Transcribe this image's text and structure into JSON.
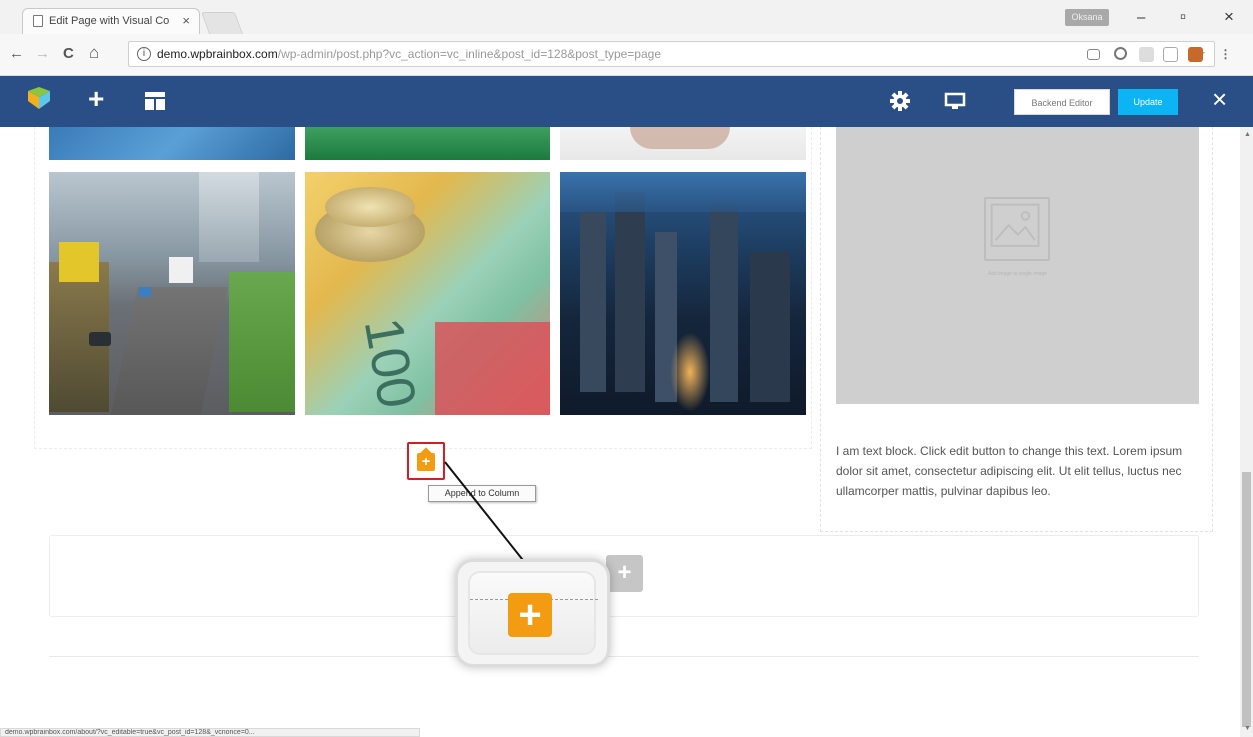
{
  "browser": {
    "tab_title": "Edit Page with Visual Co",
    "tab_close": "×",
    "profile_label": "Oksana",
    "window_controls": {
      "minimize": "–",
      "maximize": "▫",
      "close": "×"
    },
    "nav": {
      "back": "←",
      "forward": "→",
      "reload": "C",
      "home": "⌂"
    },
    "url_host": "demo.wpbrainbox.com",
    "url_path": "/wp-admin/post.php?vc_action=vc_inline&post_id=128&post_type=page",
    "info_icon": "i",
    "bookmark": "☆",
    "extensions": [
      "camera-icon",
      "search-icon",
      "puzzle-icon",
      "pocket-icon",
      "adblock-icon",
      "menu-icon"
    ]
  },
  "vc_toolbar": {
    "backend_editor_label": "Backend Editor",
    "update_label": "Update",
    "close": "×",
    "add": "+",
    "accent_color": "#2a4f86",
    "update_color": "#0db4f3"
  },
  "content": {
    "placeholder_caption": "Add image to\nsingle image",
    "text_block": "I am text block. Click edit button to change this text. Lorem ipsum dolor sit amet, consectetur adipiscing elit. Ut elit tellus, luctus nec ullamcorper mattis, pulvinar dapibus leo.",
    "append_tooltip": "Append to Column",
    "append_symbol": "+",
    "add_row_symbol": "+",
    "gallery_images": [
      "ocean-image",
      "green-image",
      "food-image",
      "highway-traffic-image",
      "australian-money-image",
      "city-night-image"
    ]
  },
  "statusbar": {
    "url": "demo.wpbrainbox.com/about/?vc_editable=true&vc_post_id=128&_vcnonce=0..."
  }
}
